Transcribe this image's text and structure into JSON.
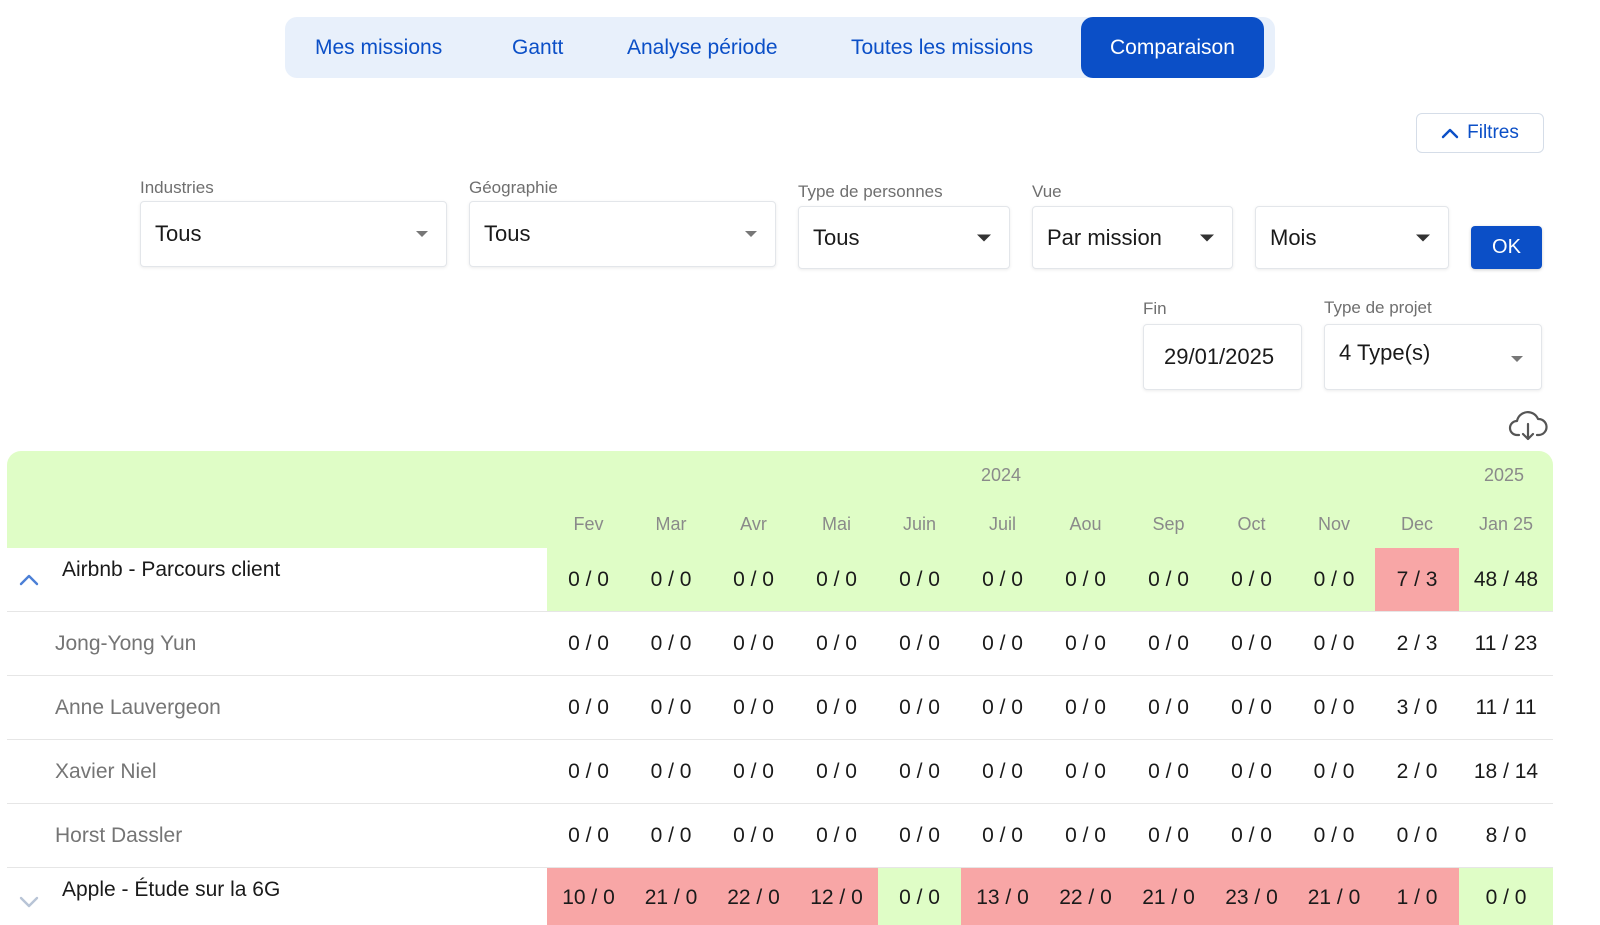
{
  "tabs": [
    {
      "label": "Mes missions"
    },
    {
      "label": "Gantt"
    },
    {
      "label": "Analyse période"
    },
    {
      "label": "Toutes les missions"
    },
    {
      "label": "Comparaison",
      "active": true
    }
  ],
  "filters_toggle": {
    "label": "Filtres"
  },
  "filters": {
    "industries": {
      "label": "Industries",
      "value": "Tous"
    },
    "geographie": {
      "label": "Géographie",
      "value": "Tous"
    },
    "type_personnes": {
      "label": "Type de personnes",
      "value": "Tous"
    },
    "vue": {
      "label": "Vue",
      "value": "Par mission"
    },
    "period": {
      "value": "Mois"
    },
    "ok_label": "OK",
    "fin": {
      "label": "Fin",
      "value": "29/01/2025"
    },
    "type_projet": {
      "label": "Type de projet",
      "value": "4 Type(s)"
    }
  },
  "table": {
    "years": [
      "2024",
      "2025"
    ],
    "months": [
      "Fev",
      "Mar",
      "Avr",
      "Mai",
      "Juin",
      "Juil",
      "Aou",
      "Sep",
      "Oct",
      "Nov",
      "Dec",
      "Jan 25"
    ],
    "rows": [
      {
        "type": "mission",
        "expanded": true,
        "name": "Airbnb - Parcours client",
        "cells": [
          "0 / 0",
          "0 / 0",
          "0 / 0",
          "0 / 0",
          "0 / 0",
          "0 / 0",
          "0 / 0",
          "0 / 0",
          "0 / 0",
          "0 / 0",
          "7 / 3",
          "48 / 48"
        ],
        "status": [
          "green",
          "green",
          "green",
          "green",
          "green",
          "green",
          "green",
          "green",
          "green",
          "green",
          "red",
          "green"
        ]
      },
      {
        "type": "person",
        "name": "Jong-Yong Yun",
        "cells": [
          "0 / 0",
          "0 / 0",
          "0 / 0",
          "0 / 0",
          "0 / 0",
          "0 / 0",
          "0 / 0",
          "0 / 0",
          "0 / 0",
          "0 / 0",
          "2 / 3",
          "11 / 23"
        ]
      },
      {
        "type": "person",
        "name": "Anne Lauvergeon",
        "cells": [
          "0 / 0",
          "0 / 0",
          "0 / 0",
          "0 / 0",
          "0 / 0",
          "0 / 0",
          "0 / 0",
          "0 / 0",
          "0 / 0",
          "0 / 0",
          "3 / 0",
          "11 / 11"
        ]
      },
      {
        "type": "person",
        "name": "Xavier Niel",
        "cells": [
          "0 / 0",
          "0 / 0",
          "0 / 0",
          "0 / 0",
          "0 / 0",
          "0 / 0",
          "0 / 0",
          "0 / 0",
          "0 / 0",
          "0 / 0",
          "2 / 0",
          "18 / 14"
        ]
      },
      {
        "type": "person",
        "name": "Horst Dassler",
        "cells": [
          "0 / 0",
          "0 / 0",
          "0 / 0",
          "0 / 0",
          "0 / 0",
          "0 / 0",
          "0 / 0",
          "0 / 0",
          "0 / 0",
          "0 / 0",
          "0 / 0",
          "8 / 0"
        ]
      },
      {
        "type": "mission",
        "expanded": false,
        "name": "Apple - Étude sur la 6G",
        "cells": [
          "10 / 0",
          "21 / 0",
          "22 / 0",
          "12 / 0",
          "0 / 0",
          "13 / 0",
          "22 / 0",
          "21 / 0",
          "23 / 0",
          "21 / 0",
          "1 / 0",
          "0 / 0"
        ],
        "status": [
          "red",
          "red",
          "red",
          "red",
          "green",
          "red",
          "red",
          "red",
          "red",
          "red",
          "red",
          "green"
        ]
      }
    ]
  },
  "colors": {
    "accent": "#0b4fc7",
    "header_bg": "#dffdc6",
    "ok_cell": "#dffdc6",
    "over_cell": "#f8a6a6"
  },
  "icons": {
    "filters_toggle": "chevron-up-icon",
    "download": "cloud-download-icon",
    "expanded_row": "chevron-up-icon",
    "collapsed_row": "chevron-down-icon"
  }
}
